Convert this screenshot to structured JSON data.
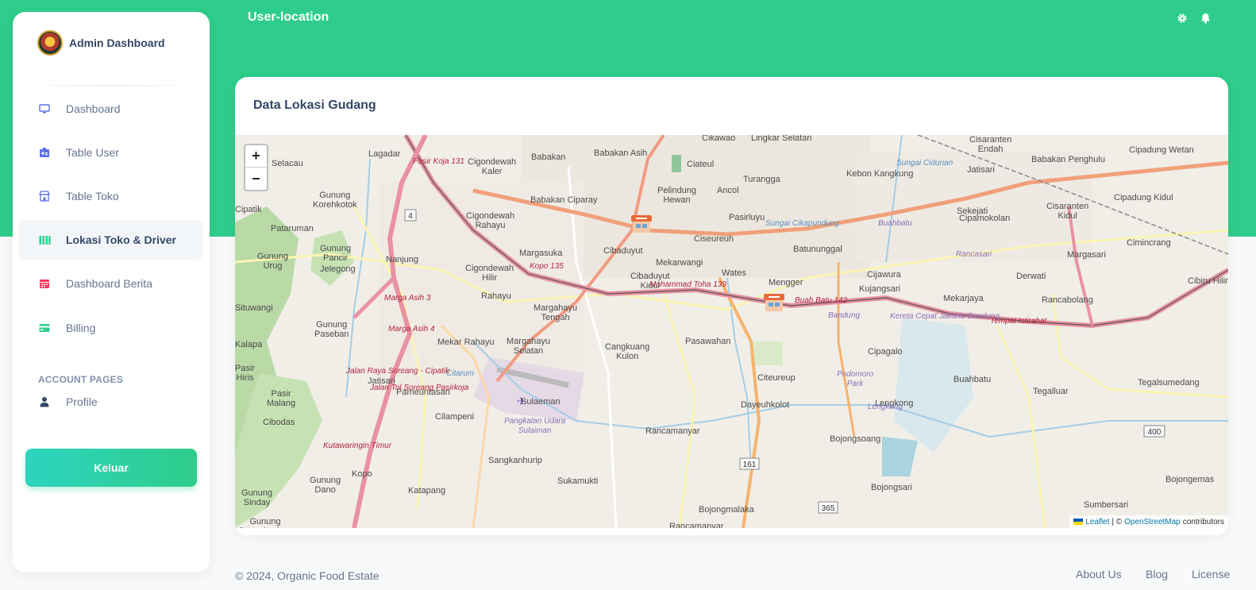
{
  "brand": {
    "name": "Admin Dashboard",
    "logo_icon": "emblem-logo"
  },
  "sidebar": {
    "items": [
      {
        "label": "Dashboard",
        "icon": "monitor-icon"
      },
      {
        "label": "Table User",
        "icon": "id-card-icon"
      },
      {
        "label": "Table Toko",
        "icon": "store-icon"
      },
      {
        "label": "Lokasi Toko & Driver",
        "icon": "map-location-icon",
        "active": true
      },
      {
        "label": "Dashboard Berita",
        "icon": "calendar-icon"
      },
      {
        "label": "Billing",
        "icon": "credit-card-icon"
      }
    ],
    "section_title": "ACCOUNT PAGES",
    "account_items": [
      {
        "label": "Profile",
        "icon": "user-icon"
      }
    ],
    "logout_label": "Keluar"
  },
  "header": {
    "title": "User-location",
    "icons": [
      "gear-icon",
      "bell-icon"
    ]
  },
  "card": {
    "title": "Data Lokasi Gudang"
  },
  "map": {
    "zoom_in": "+",
    "zoom_out": "−",
    "attribution": {
      "leaflet": "Leaflet",
      "separator": "| ©",
      "osm": "OpenStreetMap",
      "suffix": "contributors"
    },
    "places": [
      "Selacau",
      "Lagadar",
      "Cigondewah Kaler",
      "Babakan",
      "Babakan Asih",
      "Ciateul",
      "Cikawao",
      "Lingkar Selatan",
      "Cisaranten Endah",
      "Babakan Penghulu",
      "Cipadung Wetan",
      "Jatisari",
      "Kebon Kangkung",
      "Turangga",
      "Pelindung Hewan",
      "Ancol",
      "Babakan Ciparay",
      "Cigondewah Rahayu",
      "Gunung Korehkotok",
      "Cipatik",
      "Pataruman",
      "Nanjung",
      "Gunung Pancir",
      "Jelegong",
      "Gunung Urug",
      "Margasuka",
      "Cibaduyut",
      "Mekarwangi",
      "Ciseureuh",
      "Pasirluyu",
      "Batununggal",
      "Sekejati",
      "Cipamokolan",
      "Cisaranten Kidul",
      "Cipadung Kidul",
      "Cimincrang",
      "Margasari",
      "Derwati",
      "Cibiru Hilir",
      "Cigondewah Hilir",
      "Cibaduyut Kidul",
      "Wates",
      "Mengger",
      "Cijawura",
      "Kujangsari",
      "Mekarjaya",
      "Rancabolang",
      "Situwangi",
      "Gunung Paseban",
      "Rahayu",
      "Margahayu Tengah",
      "Kalapa",
      "Mekar Rahayu",
      "Margahayu Selatan",
      "Cangkuang Kulon",
      "Pasawahan",
      "Cipagalo",
      "Buahbatu",
      "Tegalluar",
      "Tegalsumedang",
      "Pasir Hiris",
      "Jatisari",
      "Pasir Malang",
      "Pameuntasan",
      "Sulaeman",
      "Citeureup",
      "Dayeuhkolot",
      "Lengkong",
      "Cibodas",
      "Cilampeni",
      "Rancamanyar",
      "Bojongsoang",
      "Sangkanhurip",
      "Gunung Dano",
      "Kopo",
      "Sukamukti",
      "Bojongsari",
      "Bojongemas",
      "Katapang",
      "Gunung Sinday",
      "Sumbersari",
      "Bojongmalaka",
      "Gunung Puncaksalam",
      "Rancamanyar"
    ],
    "road_labels": [
      "Pasir Koja 131",
      "Kopo 135",
      "Marga Asih 3",
      "Marga Asih 4",
      "Mohammad Toha 139",
      "Buah Batu 142",
      "Kereta Cepat Jakarta-Bandung",
      "Tempat Istirahat",
      "Kutawaringin Timur",
      "Jalan Raya Soreang - Cipatik",
      "Jalan Tol Soreang Pasirkoja",
      "Buahbatu",
      "Rancasari",
      "Bandung",
      "Pangkalan Udara Sulaiman",
      "Podomoro Park",
      "Lengkong",
      "Citarum",
      "Sungai Cikapundung",
      "Sungai Cidurian"
    ],
    "route_shields": [
      "4",
      "161",
      "365",
      "400"
    ]
  },
  "footer": {
    "copyright": "© 2024, Organic Food Estate",
    "links": [
      "About Us",
      "Blog",
      "License"
    ]
  }
}
